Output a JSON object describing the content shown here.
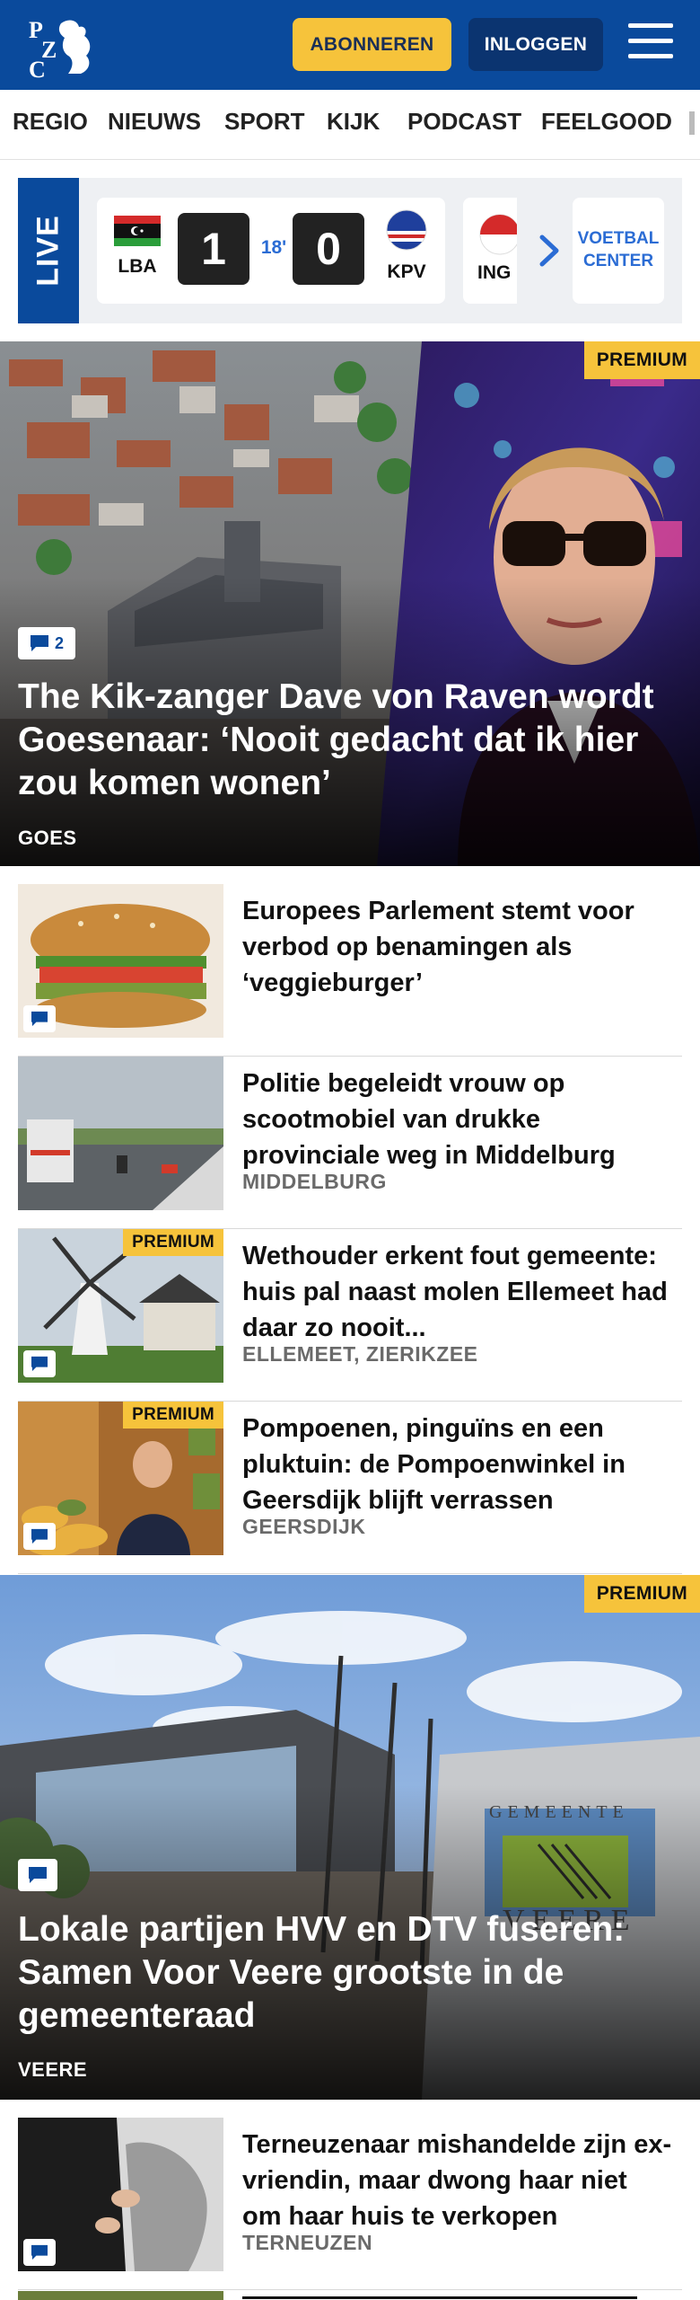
{
  "header": {
    "subscribe_label": "ABONNEREN",
    "login_label": "INLOGGEN",
    "brand_color": "#0a4a9c",
    "accent_color": "#f6c33b"
  },
  "nav": {
    "items": [
      "REGIO",
      "NIEUWS",
      "SPORT",
      "KIJK",
      "PODCAST",
      "FEELGOOD"
    ]
  },
  "live": {
    "label": "LIVE",
    "match": {
      "home": "LBA",
      "away": "KPV",
      "home_score": "1",
      "away_score": "0",
      "minute": "18'"
    },
    "next_team_partial": "ING",
    "voetbal_center_label": "VOETBAL CENTER"
  },
  "hero1": {
    "premium": "PREMIUM",
    "comments": "2",
    "title": "The Kik-zanger Dave von Raven wordt Goesenaar: ‘Nooit gedacht dat ik hier zou komen wonen’",
    "location": "GOES"
  },
  "list1": [
    {
      "title": "Europees Parlement stemt voor verbod op benamingen als ‘veggieburger’",
      "location": "",
      "premium": "",
      "thumb_icon": "burger-image"
    },
    {
      "title": "Politie begeleidt vrouw op scootmobiel van drukke provinciale weg in Middelburg",
      "location": "MIDDELBURG",
      "premium": "",
      "thumb_icon": "road-image"
    },
    {
      "title": "Wethouder erkent fout gemeente: huis pal naast molen Ellemeet had daar zo nooit...",
      "location": "ELLEMEET, ZIERIKZEE",
      "premium": "PREMIUM",
      "thumb_icon": "windmill-image"
    },
    {
      "title": "Pompoenen, pinguïns en een pluktuin: de Pompoenwinkel in Geersdijk blijft verrassen",
      "location": "GEERSDIJK",
      "premium": "PREMIUM",
      "thumb_icon": "pumpkin-shop-image"
    }
  ],
  "hero2": {
    "premium": "PREMIUM",
    "sign_text": "GEMEENTE VEERE",
    "title": "Lokale partijen HVV en DTV fuseren: Samen Voor Veere grootste in de gemeenteraad",
    "location": "VEERE"
  },
  "list2": [
    {
      "title": "Terneuzenaar mishandelde zijn ex-vriendin, maar dwong haar niet om haar huis te verkopen",
      "location": "TERNEUZEN"
    }
  ]
}
